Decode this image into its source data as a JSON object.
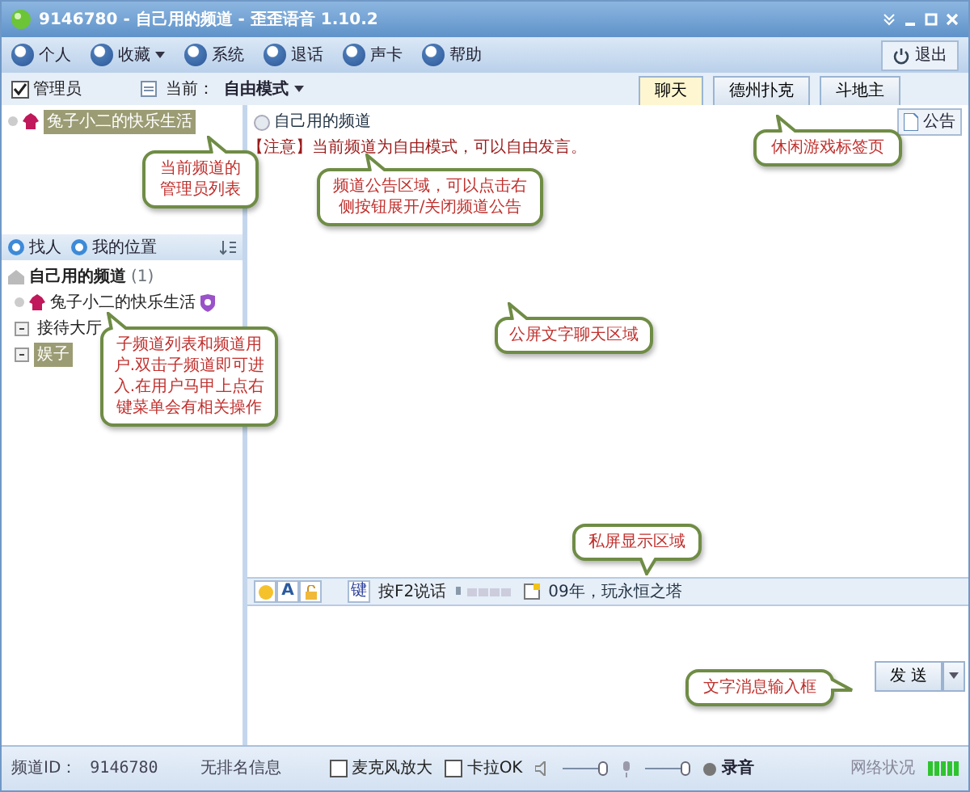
{
  "window": {
    "title": "9146780 - 自己用的频道 - 歪歪语音 1.10.2"
  },
  "toolbar": [
    {
      "label": "个人",
      "dropdown": false
    },
    {
      "label": "收藏",
      "dropdown": true
    },
    {
      "label": "系统",
      "dropdown": false
    },
    {
      "label": "退话",
      "dropdown": false
    },
    {
      "label": "声卡",
      "dropdown": false
    },
    {
      "label": "帮助",
      "dropdown": false
    }
  ],
  "exit_button": "退出",
  "admin_checkbox": {
    "label": "管理员",
    "checked": true
  },
  "mode": {
    "label": "当前：",
    "value": "自由模式"
  },
  "tabs": [
    {
      "label": "聊天",
      "selected": true
    },
    {
      "label": "德州扑克",
      "selected": false
    },
    {
      "label": "斗地主",
      "selected": false
    }
  ],
  "admin_list": [
    {
      "name": "兔子小二的快乐生活",
      "selected": true
    }
  ],
  "left_toolbar": [
    "找人",
    "我的位置"
  ],
  "channel_tree": {
    "name": "自己用的频道",
    "count": "(1)",
    "children": [
      {
        "kind": "user",
        "name": "兔子小二的快乐生活",
        "selected": false
      },
      {
        "kind": "channel",
        "name": "接待大厅",
        "selected": false
      },
      {
        "kind": "channel",
        "name": "娱子",
        "selected": true
      }
    ]
  },
  "chat": {
    "channel_name": "自己用的频道",
    "notice": "【注意】当前频道为自由模式，可以自由发言。",
    "announce_button": "公告"
  },
  "input_toolbar": {
    "font_button": "A",
    "ptt_key": "键",
    "ptt_label": "按F2说话",
    "motto": "09年，玩永恒之塔"
  },
  "send_button": "发 送",
  "status_bar": {
    "channel_id_label": "频道ID：",
    "channel_id": "9146780",
    "rank": "无排名信息",
    "checkboxes": [
      {
        "label": "麦克风放大",
        "checked": false
      },
      {
        "label": "卡拉OK",
        "checked": false
      }
    ],
    "speaker": {
      "level": 1
    },
    "mic": {
      "level": 1
    },
    "record": "录音",
    "network_label": "网络状况"
  },
  "callouts": [
    {
      "text": "当前频道的管理员列表"
    },
    {
      "text": "频道公告区域，可以点击右侧按钮展开/关闭频道公告"
    },
    {
      "text": "休闲游戏标签页"
    },
    {
      "text": "子频道列表和频道用户.双击子频道即可进入.在用户马甲上点右键菜单会有相关操作"
    },
    {
      "text": "公屏文字聊天区域"
    },
    {
      "text": "私屏显示区域"
    },
    {
      "text": "文字消息输入框"
    }
  ]
}
